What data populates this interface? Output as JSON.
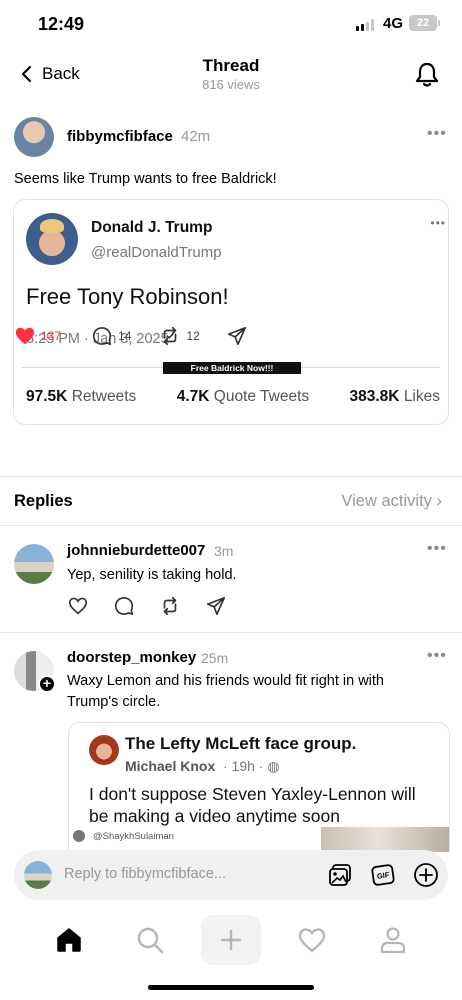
{
  "status_bar": {
    "time": "12:49",
    "network": "4G",
    "battery": "22"
  },
  "header": {
    "back_label": "Back",
    "title": "Thread",
    "views": "816 views"
  },
  "post": {
    "username": "fibbymcfibface",
    "time": "42m",
    "text": "Seems like Trump wants to free Baldrick!",
    "embed": {
      "name": "Donald J. Trump",
      "handle": "@realDonaldTrump",
      "text": "Free Tony Robinson!",
      "date": "5:25 PM · Jan 3, 2025",
      "banner": "Free Baldrick Now!!!",
      "retweets_value": "97.5K",
      "retweets_label": "Retweets",
      "quotes_value": "4.7K",
      "quotes_label": "Quote Tweets",
      "likes_value": "383.8K",
      "likes_label": "Likes"
    },
    "likes": "137",
    "comments": "14",
    "reposts": "12"
  },
  "replies_section": {
    "label": "Replies",
    "view_activity": "View activity"
  },
  "replies": [
    {
      "username": "johnnieburdette007",
      "time": "3m",
      "text": "Yep, senility is taking hold."
    },
    {
      "username": "doorstep_monkey",
      "time": "25m",
      "text": "Waxy Lemon and his friends would fit right in with Trump's circle.",
      "quote": {
        "group": "The Lefty McLeft face group.",
        "author": "Michael Knox",
        "time": "· 19h ·",
        "text": "I don't suppose Steven Yaxley-Lennon will be making a video anytime soon",
        "handle": "@ShaykhSulaiman"
      }
    }
  ],
  "reply_input": {
    "placeholder": "Reply to fibbymcfibface..."
  },
  "colors": {
    "like": "#ff3040",
    "muted": "#999999"
  },
  "icons": [
    "back-chevron-icon",
    "bell-icon",
    "more-icon",
    "heart-icon",
    "comment-icon",
    "repost-icon",
    "share-icon",
    "gallery-icon",
    "gif-icon",
    "add-icon",
    "home-icon",
    "search-icon",
    "compose-icon",
    "activity-icon",
    "profile-icon"
  ]
}
